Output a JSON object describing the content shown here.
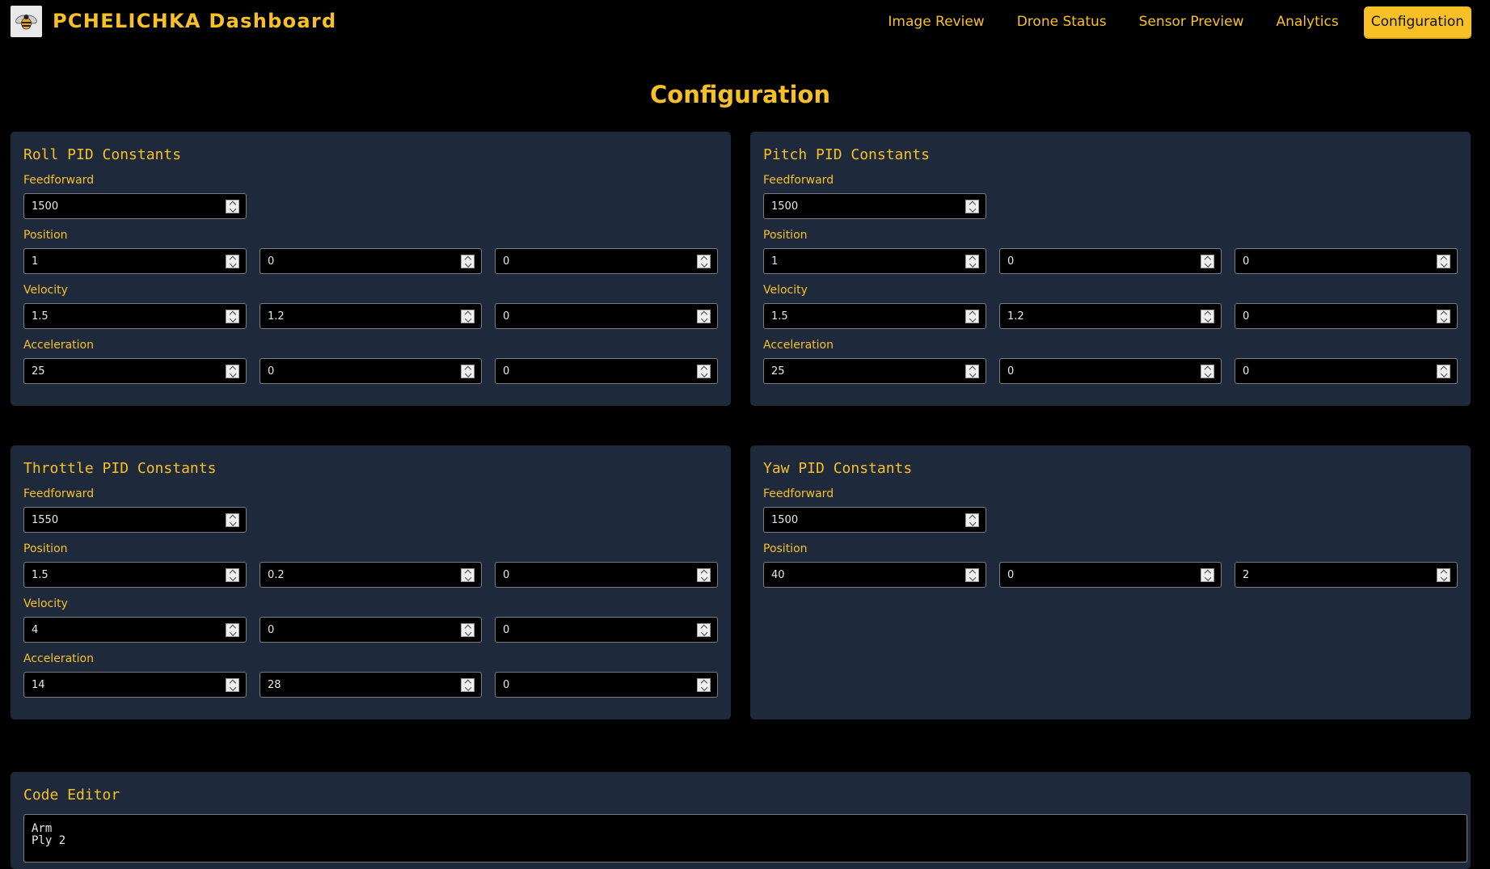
{
  "header": {
    "app_title": "PCHELICHKA Dashboard",
    "logo_icon": "bee-icon",
    "nav": [
      {
        "label": "Image Review",
        "active": false
      },
      {
        "label": "Drone Status",
        "active": false
      },
      {
        "label": "Sensor Preview",
        "active": false
      },
      {
        "label": "Analytics",
        "active": false
      },
      {
        "label": "Configuration",
        "active": true
      }
    ]
  },
  "page_title": "Configuration",
  "colors": {
    "accent": "#f6c026",
    "panel": "#1e293b",
    "background": "#000000"
  },
  "panels": {
    "roll": {
      "title": "Roll PID Constants",
      "feedforward_label": "Feedforward",
      "feedforward": "1500",
      "position_label": "Position",
      "position": [
        "1",
        "0",
        "0"
      ],
      "velocity_label": "Velocity",
      "velocity": [
        "1.5",
        "1.2",
        "0"
      ],
      "acceleration_label": "Acceleration",
      "acceleration": [
        "25",
        "0",
        "0"
      ]
    },
    "pitch": {
      "title": "Pitch PID Constants",
      "feedforward_label": "Feedforward",
      "feedforward": "1500",
      "position_label": "Position",
      "position": [
        "1",
        "0",
        "0"
      ],
      "velocity_label": "Velocity",
      "velocity": [
        "1.5",
        "1.2",
        "0"
      ],
      "acceleration_label": "Acceleration",
      "acceleration": [
        "25",
        "0",
        "0"
      ]
    },
    "throttle": {
      "title": "Throttle PID Constants",
      "feedforward_label": "Feedforward",
      "feedforward": "1550",
      "position_label": "Position",
      "position": [
        "1.5",
        "0.2",
        "0"
      ],
      "velocity_label": "Velocity",
      "velocity": [
        "4",
        "0",
        "0"
      ],
      "acceleration_label": "Acceleration",
      "acceleration": [
        "14",
        "28",
        "0"
      ]
    },
    "yaw": {
      "title": "Yaw PID Constants",
      "feedforward_label": "Feedforward",
      "feedforward": "1500",
      "position_label": "Position",
      "position": [
        "40",
        "0",
        "2"
      ]
    }
  },
  "code_editor": {
    "title": "Code Editor",
    "content": "Arm\nPly 2"
  }
}
